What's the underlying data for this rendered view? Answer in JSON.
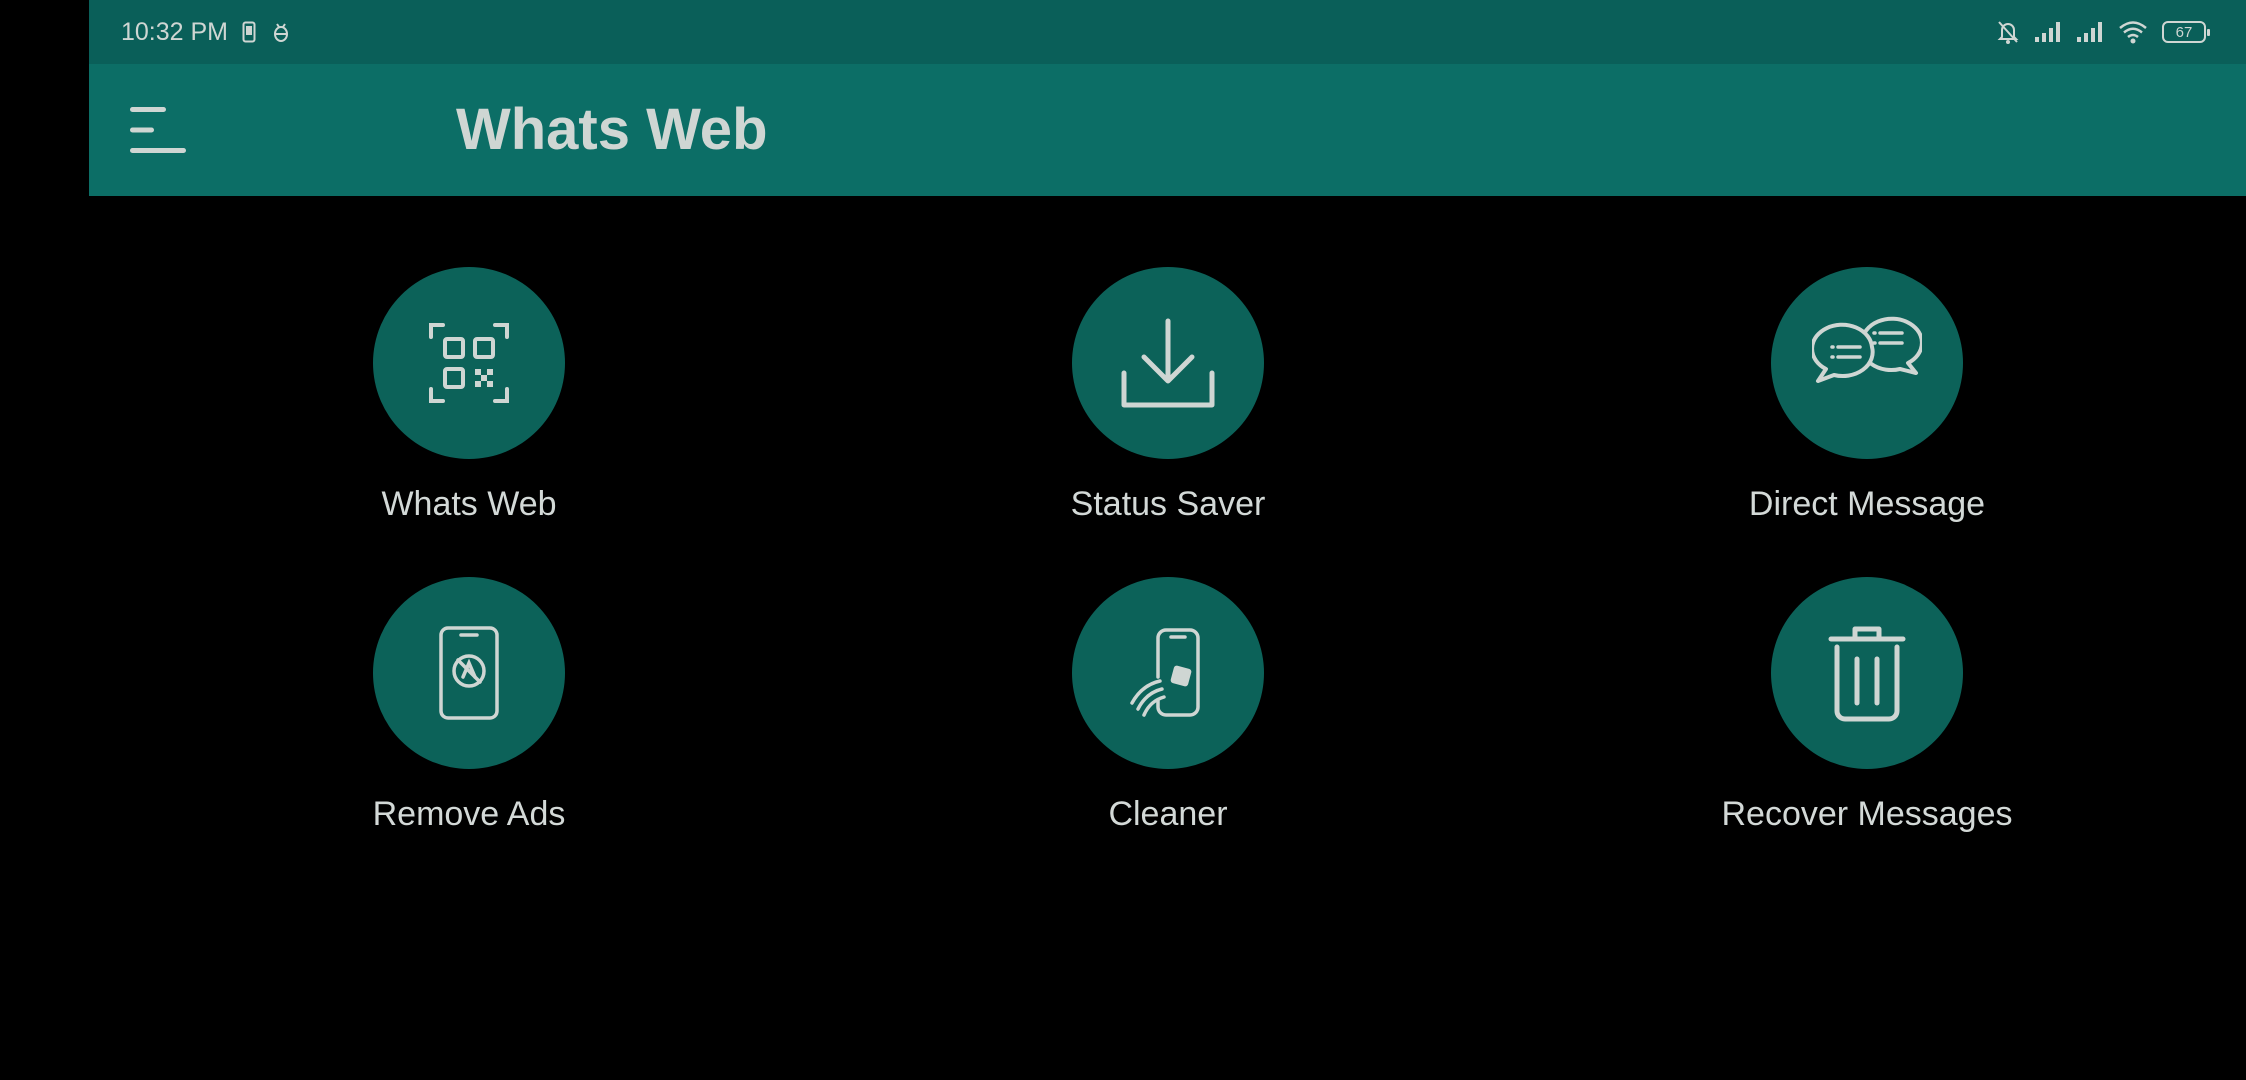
{
  "status_bar": {
    "time": "10:32 PM",
    "battery": "67",
    "icons": [
      "sim-icon",
      "bug-icon",
      "muted-bell-icon",
      "signal-icon",
      "signal-icon",
      "wifi-icon",
      "battery-icon"
    ]
  },
  "app_bar": {
    "title": "Whats Web",
    "menu_icon": "hamburger-menu-icon"
  },
  "colors": {
    "status_bar_bg": "#0a5f59",
    "app_bar_bg": "#0c6e66",
    "circle_bg": "#0c6259",
    "text": "#d3d9d7",
    "background": "#000000"
  },
  "features": [
    {
      "label": "Whats Web",
      "icon": "qr-scan-icon"
    },
    {
      "label": "Status Saver",
      "icon": "download-icon"
    },
    {
      "label": "Direct Message",
      "icon": "chat-bubbles-icon"
    },
    {
      "label": "Remove Ads",
      "icon": "no-ads-phone-icon"
    },
    {
      "label": "Cleaner",
      "icon": "phone-clean-icon"
    },
    {
      "label": "Recover Messages",
      "icon": "trash-icon"
    }
  ]
}
